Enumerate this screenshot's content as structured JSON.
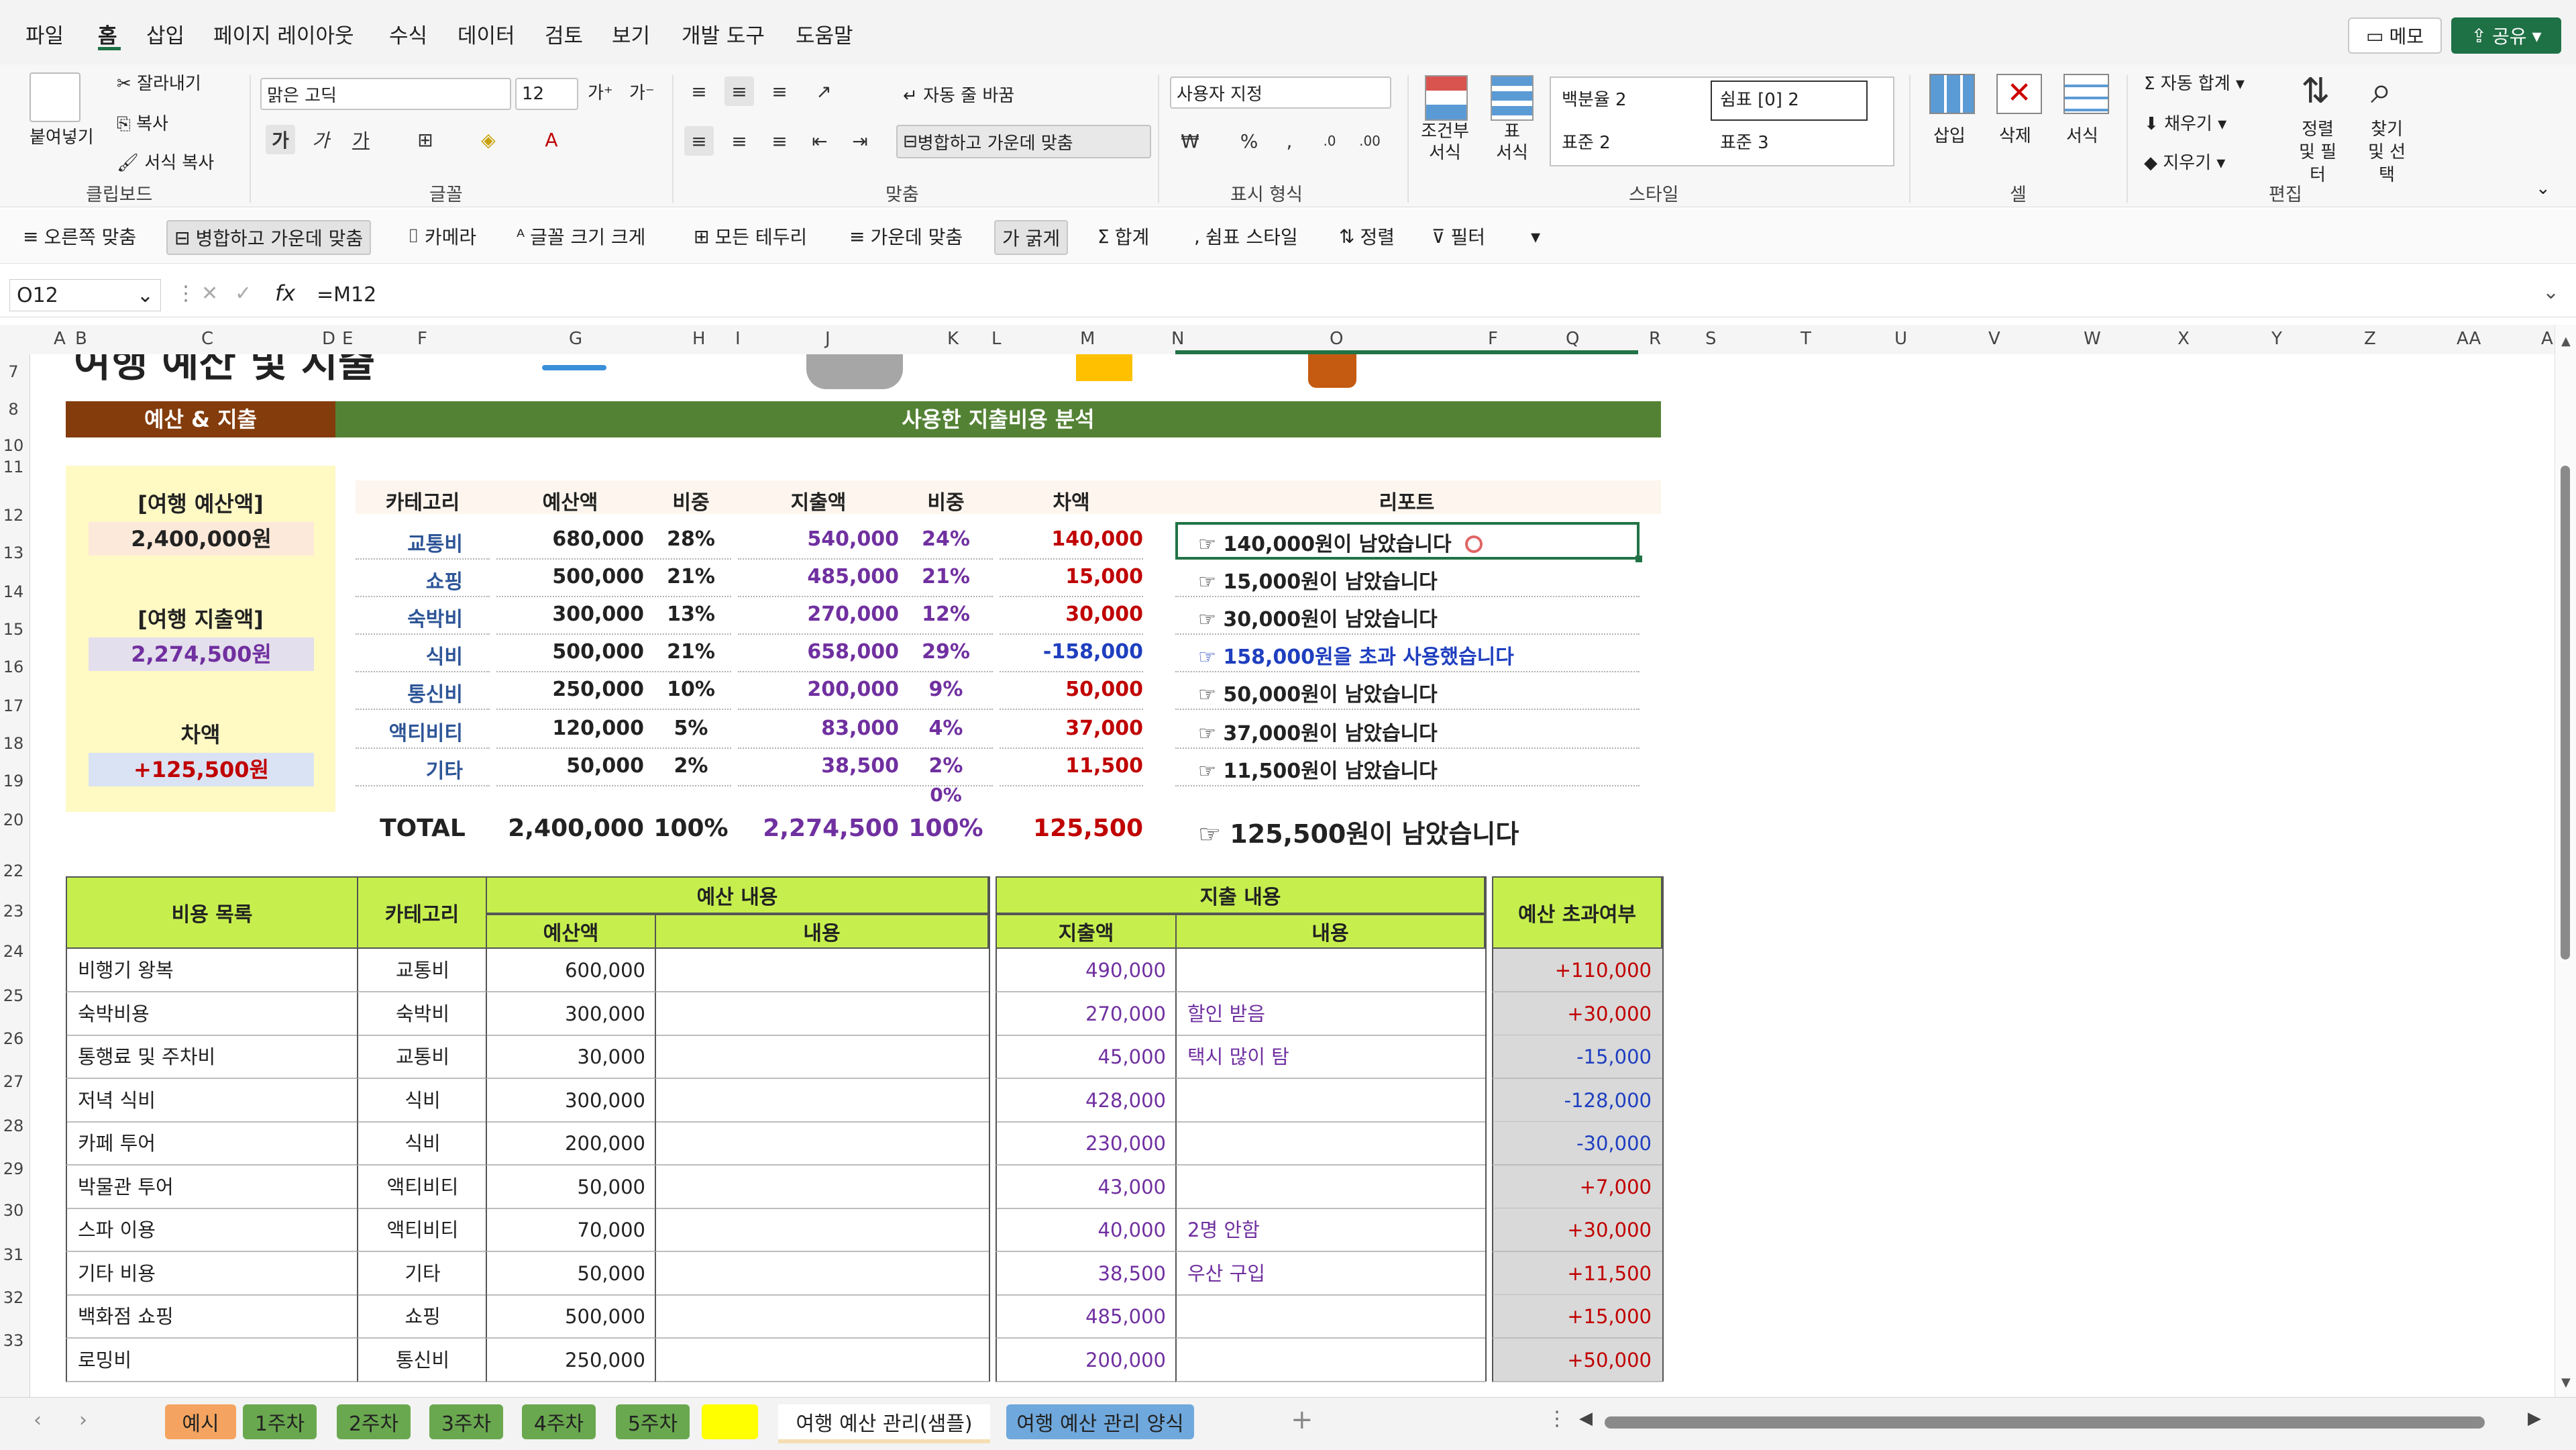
{
  "menu": {
    "items": [
      "파일",
      "홈",
      "삽입",
      "페이지 레이아웃",
      "수식",
      "데이터",
      "검토",
      "보기",
      "개발 도구",
      "도움말"
    ],
    "memo": "메모",
    "share": "공유"
  },
  "ribbon": {
    "paste": "붙여넣기",
    "cut": "잘라내기",
    "copy": "복사",
    "format_painter": "서식 복사",
    "clipboard": "클립보드",
    "font_name": "맑은 고딕",
    "font_size": "12",
    "font_group": "글꼴",
    "bold": "가",
    "italic": "가",
    "underline": "가",
    "grow": "가",
    "shrink": "가",
    "wrap_text": "자동 줄 바꿈",
    "merge_center": "병합하고 가운데 맞춤",
    "align_group": "맞춤",
    "number_format": "사용자 지정",
    "number_group": "표시 형식",
    "cond_format": "조건부 서식",
    "table_format": "표 서식",
    "style_percent": "백분율 2",
    "style_comma": "쉼표 [0] 2",
    "style_normal2": "표준 2",
    "style_normal3": "표준 3",
    "styles_group": "스타일",
    "insert": "삽입",
    "delete": "삭제",
    "format": "서식",
    "cells_group": "셀",
    "autosum": "자동 합계",
    "fill": "채우기",
    "clear": "지우기",
    "sort_filter": "정렬 및 필터",
    "find_select": "찾기 및 선택",
    "editing_group": "편집"
  },
  "quickbar": [
    "오른쪽 맞춤",
    "병합하고 가운데 맞춤",
    "카메라",
    "글꼴 크기 크게",
    "모든 테두리",
    "가운데 맞춤",
    "가 굵게",
    "합계",
    "쉼표 스타일",
    "정렬",
    "필터"
  ],
  "formula": {
    "namebox": "O12",
    "fx": "fx",
    "content": "=M12"
  },
  "columns": [
    "A",
    "B",
    "C",
    "D",
    "E",
    "F",
    "G",
    "H",
    "I",
    "J",
    "K",
    "L",
    "M",
    "N",
    "O",
    "F",
    "Q",
    "R",
    "S",
    "T",
    "U",
    "V",
    "W",
    "X",
    "Y",
    "Z",
    "AA",
    "A"
  ],
  "rows": [
    "7",
    "8",
    "10",
    "11",
    "12",
    "13",
    "14",
    "15",
    "16",
    "17",
    "18",
    "19",
    "20",
    "22",
    "23",
    "24",
    "25",
    "26",
    "27",
    "28",
    "29",
    "30",
    "31",
    "32",
    "33"
  ],
  "sheet": {
    "title_partial": "여행 예산 및 지출",
    "budget_header": "예산 & 지출",
    "analysis_header": "사용한 지출비용 분석",
    "summary": {
      "budget_label": "[여행 예산액]",
      "budget_value": "2,400,000원",
      "spent_label": "[여행 지출액]",
      "spent_value": "2,274,500원",
      "diff_label": "차액",
      "diff_value": "+125,500원"
    },
    "analysis_headers": [
      "카테고리",
      "예산액",
      "비중",
      "지출액",
      "비중",
      "차액",
      "리포트"
    ],
    "analysis_rows": [
      {
        "cat": "교통비",
        "budget": "680,000",
        "bpct": "28%",
        "spent": "540,000",
        "spct": "24%",
        "diff": "140,000",
        "report": "☞ 140,000원이 남았습니다",
        "over": false
      },
      {
        "cat": "쇼핑",
        "budget": "500,000",
        "bpct": "21%",
        "spent": "485,000",
        "spct": "21%",
        "diff": "15,000",
        "report": "☞ 15,000원이 남았습니다",
        "over": false
      },
      {
        "cat": "숙박비",
        "budget": "300,000",
        "bpct": "13%",
        "spent": "270,000",
        "spct": "12%",
        "diff": "30,000",
        "report": "☞ 30,000원이 남았습니다",
        "over": false
      },
      {
        "cat": "식비",
        "budget": "500,000",
        "bpct": "21%",
        "spent": "658,000",
        "spct": "29%",
        "diff": "-158,000",
        "report": "☞ 158,000원을 초과 사용했습니다",
        "over": true
      },
      {
        "cat": "통신비",
        "budget": "250,000",
        "bpct": "10%",
        "spent": "200,000",
        "spct": "9%",
        "diff": "50,000",
        "report": "☞ 50,000원이 남았습니다",
        "over": false
      },
      {
        "cat": "액티비티",
        "budget": "120,000",
        "bpct": "5%",
        "spent": "83,000",
        "spct": "4%",
        "diff": "37,000",
        "report": "☞ 37,000원이 남았습니다",
        "over": false
      },
      {
        "cat": "기타",
        "budget": "50,000",
        "bpct": "2%",
        "spent": "38,500",
        "spct": "2%",
        "diff": "11,500",
        "report": "☞ 11,500원이 남았습니다",
        "over": false
      }
    ],
    "row19_pct": "0%",
    "total": {
      "label": "TOTAL",
      "budget": "2,400,000",
      "bpct": "100%",
      "spent": "2,274,500",
      "spct": "100%",
      "diff": "125,500",
      "report": "☞ 125,500원이 남았습니다"
    },
    "detail_headers": {
      "item": "비용 목록",
      "category": "카테고리",
      "budget_group": "예산 내용",
      "budget": "예산액",
      "budget_note": "내용",
      "spent_group": "지출 내용",
      "spent": "지출액",
      "spent_note": "내용",
      "over": "예산 초과여부"
    },
    "detail_rows": [
      {
        "item": "비행기 왕복",
        "cat": "교통비",
        "budget": "600,000",
        "bnote": "",
        "spent": "490,000",
        "snote": "",
        "over": "+110,000"
      },
      {
        "item": "숙박비용",
        "cat": "숙박비",
        "budget": "300,000",
        "bnote": "",
        "spent": "270,000",
        "snote": "할인 받음",
        "over": "+30,000"
      },
      {
        "item": "통행료 및 주차비",
        "cat": "교통비",
        "budget": "30,000",
        "bnote": "",
        "spent": "45,000",
        "snote": "택시 많이 탐",
        "over": "-15,000"
      },
      {
        "item": "저녁 식비",
        "cat": "식비",
        "budget": "300,000",
        "bnote": "",
        "spent": "428,000",
        "snote": "",
        "over": "-128,000"
      },
      {
        "item": "카페 투어",
        "cat": "식비",
        "budget": "200,000",
        "bnote": "",
        "spent": "230,000",
        "snote": "",
        "over": "-30,000"
      },
      {
        "item": "박물관 투어",
        "cat": "액티비티",
        "budget": "50,000",
        "bnote": "",
        "spent": "43,000",
        "snote": "",
        "over": "+7,000"
      },
      {
        "item": "스파 이용",
        "cat": "액티비티",
        "budget": "70,000",
        "bnote": "",
        "spent": "40,000",
        "snote": "2명 안함",
        "over": "+30,000"
      },
      {
        "item": "기타 비용",
        "cat": "기타",
        "budget": "50,000",
        "bnote": "",
        "spent": "38,500",
        "snote": "우산 구입",
        "over": "+11,500"
      },
      {
        "item": "백화점 쇼핑",
        "cat": "쇼핑",
        "budget": "500,000",
        "bnote": "",
        "spent": "485,000",
        "snote": "",
        "over": "+15,000"
      },
      {
        "item": "로밍비",
        "cat": "통신비",
        "budget": "250,000",
        "bnote": "",
        "spent": "200,000",
        "snote": "",
        "over": "+50,000"
      }
    ]
  },
  "tabs": [
    {
      "label": "예시",
      "color": "#f4a460"
    },
    {
      "label": "1주차",
      "color": "#6aa84f"
    },
    {
      "label": "2주차",
      "color": "#6aa84f"
    },
    {
      "label": "3주차",
      "color": "#6aa84f"
    },
    {
      "label": "4주차",
      "color": "#6aa84f"
    },
    {
      "label": "5주차",
      "color": "#6aa84f"
    },
    {
      "label": "",
      "color": "#ffff00"
    },
    {
      "label": "여행 예산 관리(샘플)",
      "color": "#f5deb3"
    },
    {
      "label": "여행 예산 관리 양식",
      "color": "#6fa8dc"
    }
  ],
  "colors": {
    "brown": "#843c0c",
    "green": "#548235",
    "lime": "#c6ef4e",
    "cream": "#fff9c4",
    "accent": "#1e7145"
  }
}
